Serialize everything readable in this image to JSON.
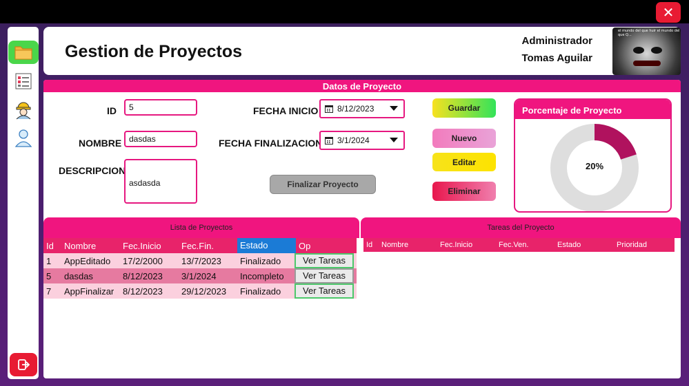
{
  "window": {
    "close_glyph": "✕"
  },
  "sidebar": {
    "items": [
      {
        "name": "folder-icon",
        "active": true
      },
      {
        "name": "task-list-icon",
        "active": false
      },
      {
        "name": "worker-icon",
        "active": false
      },
      {
        "name": "user-icon",
        "active": false
      }
    ],
    "logout_icon": "logout-icon"
  },
  "header": {
    "title": "Gestion de Proyectos",
    "role": "Administrador",
    "user_name": "Tomas Aguilar",
    "avatar_caption": "el mundo del que huir el mundo del que Q..."
  },
  "form": {
    "section_title": "Datos de Proyecto",
    "id_label": "ID",
    "id_value": "5",
    "nombre_label": "NOMBRE",
    "nombre_value": "dasdas",
    "descripcion_label": "DESCRIPCION",
    "descripcion_value": "asdasda",
    "fecha_inicio_label": "FECHA INICIO",
    "fecha_inicio_value": "8/12/2023",
    "fecha_fin_label": "FECHA FINALIZACION",
    "fecha_fin_value": "3/1/2024",
    "finalizar_label": "Finalizar Proyecto",
    "guardar_label": "Guardar",
    "nuevo_label": "Nuevo",
    "editar_label": "Editar",
    "eliminar_label": "Eliminar"
  },
  "progress": {
    "title": "Porcentaje de Proyecto",
    "label": "20%",
    "fraction": 0.2,
    "fill_color": "#b0125e",
    "track_color": "#dedede"
  },
  "projects": {
    "title": "Lista de Proyectos",
    "columns": [
      "Id",
      "Nombre",
      "Fec.Inicio",
      "Fec.Fin.",
      "Estado",
      "Op"
    ],
    "rows": [
      {
        "id": "1",
        "nombre": "AppEditado",
        "inicio": "17/2/2000",
        "fin": "13/7/2023",
        "estado": "Finalizado",
        "op": "Ver Tareas"
      },
      {
        "id": "5",
        "nombre": "dasdas",
        "inicio": "8/12/2023",
        "fin": "3/1/2024",
        "estado": "Incompleto",
        "op": "Ver Tareas"
      },
      {
        "id": "7",
        "nombre": "AppFinalizar",
        "inicio": "8/12/2023",
        "fin": "29/12/2023",
        "estado": "Finalizado",
        "op": "Ver Tareas"
      }
    ]
  },
  "tasks": {
    "title": "Tareas del Proyecto",
    "columns": [
      "Id",
      "Nombre",
      "Fec.Inicio",
      "Fec.Ven.",
      "Estado",
      "Prioridad"
    ]
  },
  "colors": {
    "accent": "#f0157f",
    "active_nav": "#4ad64a",
    "danger": "#e81b33"
  }
}
